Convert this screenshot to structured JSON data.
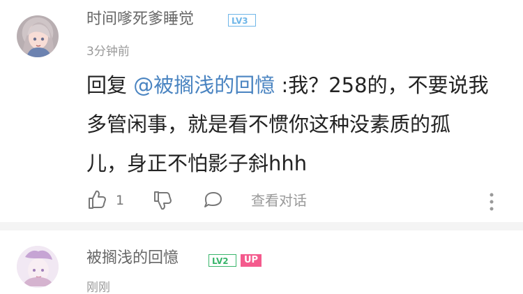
{
  "comments": [
    {
      "username": "时间嗲死爹睡觉",
      "level": "LV3",
      "time": "3分钟前",
      "reply_prefix": "回复 ",
      "mention": "@被搁浅的回憶",
      "text_line1": " :我？258的，不要说我",
      "text_line2": "多管闲事，就是看不惯你这种没素质的孤",
      "text_line3": "儿，身正不怕影子斜hhh",
      "like_count": "1",
      "view_dialog": "查看对话"
    },
    {
      "username": "被搁浅的回憶",
      "level": "LV2",
      "up_badge": "UP",
      "time": "刚刚"
    }
  ],
  "colors": {
    "mention": "#4a84c1",
    "level3_badge": "#6fb6e8",
    "level2_badge": "#39b56b",
    "up_badge": "#f45a8d"
  }
}
